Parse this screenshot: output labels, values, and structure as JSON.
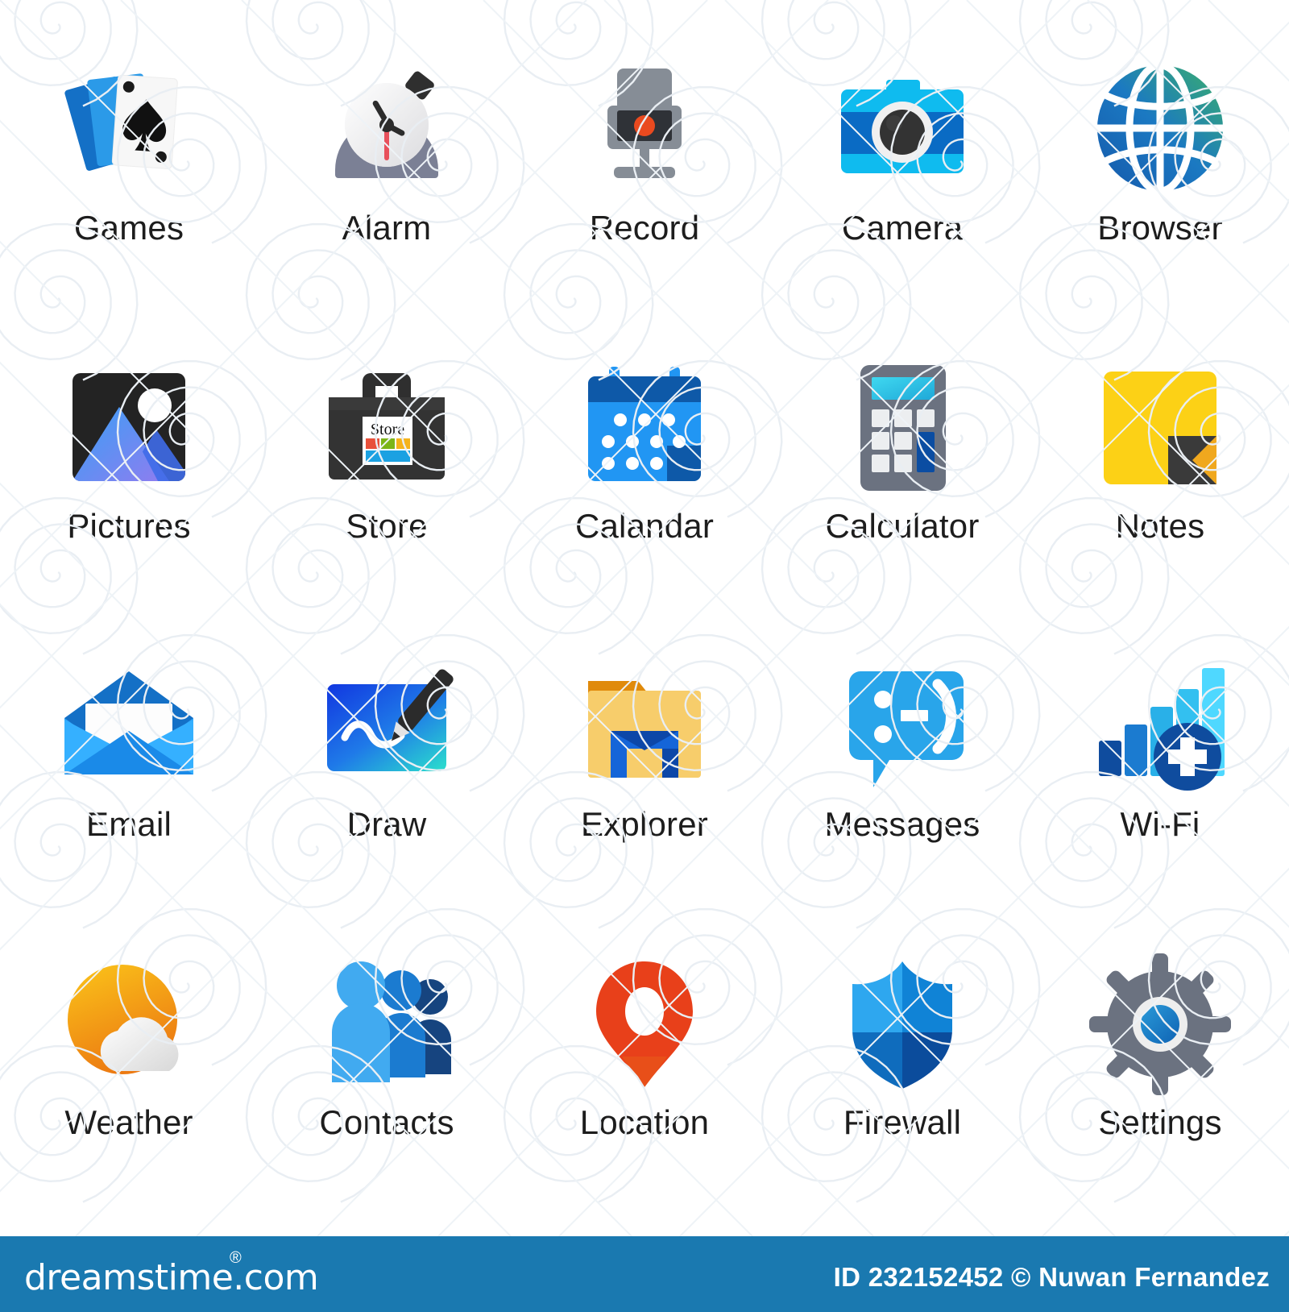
{
  "sheet": {
    "columns": 5,
    "rows": 4,
    "background": "#ffffff",
    "label_color": "#1d1d1d"
  },
  "icons": [
    {
      "label": "Games",
      "icon": "playing-cards-icon",
      "colors": [
        "#0f6cbd",
        "#2b9ae8",
        "#ffffff",
        "#1a1a1a"
      ]
    },
    {
      "label": "Alarm",
      "icon": "alarm-clock-icon",
      "colors": [
        "#7b8095",
        "#f2f2f4",
        "#2c2c2c",
        "#e8505b"
      ]
    },
    {
      "label": "Record",
      "icon": "microphone-icon",
      "colors": [
        "#868d96",
        "#2f3237",
        "#ea4a1f"
      ]
    },
    {
      "label": "Camera",
      "icon": "camera-icon",
      "colors": [
        "#0fbbef",
        "#0a6bc4",
        "#eeeeee",
        "#333333"
      ]
    },
    {
      "label": "Browser",
      "icon": "globe-icon",
      "colors": [
        "#1b79c2",
        "#37a86b",
        "#ffffff"
      ]
    },
    {
      "label": "Pictures",
      "icon": "photo-icon",
      "colors": [
        "#232323",
        "#38a0f5",
        "#8b7ef0",
        "#ffffff"
      ]
    },
    {
      "label": "Store",
      "icon": "shopping-bag-icon",
      "colors": [
        "#2f2f2f",
        "#ffffff",
        "#e8503a",
        "#7cb518",
        "#f5b31b",
        "#1ba1e2"
      ]
    },
    {
      "label": "Calandar",
      "icon": "calendar-icon",
      "colors": [
        "#0e59a8",
        "#2196f3",
        "#ffffff"
      ]
    },
    {
      "label": "Calculator",
      "icon": "calculator-icon",
      "colors": [
        "#6b7280",
        "#3cd0ee",
        "#eceef0",
        "#0b4da2"
      ]
    },
    {
      "label": "Notes",
      "icon": "sticky-note-icon",
      "colors": [
        "#fcd116",
        "#3a3a3a",
        "#f0a81e"
      ]
    },
    {
      "label": "Email",
      "icon": "envelope-icon",
      "colors": [
        "#1470c6",
        "#2fa3f7",
        "#ffffff"
      ]
    },
    {
      "label": "Draw",
      "icon": "pen-tablet-icon",
      "colors": [
        "#1137e0",
        "#2ad6cf",
        "#2b2b2b",
        "#ffffff"
      ]
    },
    {
      "label": "Explorer",
      "icon": "folder-icon",
      "colors": [
        "#e08a0b",
        "#f7cd6b",
        "#1565d8",
        "#0c47a8"
      ]
    },
    {
      "label": "Messages",
      "icon": "chat-bubble-icon",
      "colors": [
        "#29a5ea",
        "#ffffff"
      ]
    },
    {
      "label": "Wi-Fi",
      "icon": "signal-bars-plus-icon",
      "colors": [
        "#0f4c9e",
        "#1b7bd0",
        "#33c0f0",
        "#4fd8ff"
      ]
    },
    {
      "label": "Weather",
      "icon": "sun-cloud-icon",
      "colors": [
        "#fbbd18",
        "#ec7a12",
        "#ffffff",
        "#dddddd"
      ]
    },
    {
      "label": "Contacts",
      "icon": "people-group-icon",
      "colors": [
        "#41aaf0",
        "#1b7bd0",
        "#16447f"
      ]
    },
    {
      "label": "Location",
      "icon": "map-pin-icon",
      "colors": [
        "#e8401a",
        "#ffffff"
      ]
    },
    {
      "label": "Firewall",
      "icon": "shield-icon",
      "colors": [
        "#2ea7ef",
        "#1083d6",
        "#0f6cbd",
        "#0b4c9c"
      ]
    },
    {
      "label": "Settings",
      "icon": "gear-icon",
      "colors": [
        "#6b7280",
        "#eeeeee",
        "#1878c8"
      ]
    }
  ],
  "footer": {
    "brand": "dreamstime.com",
    "registered_mark": "®",
    "credit": "ID 232152452 © Nuwan Fernandez",
    "background": "#1a79b0",
    "text_color": "#ffffff"
  }
}
